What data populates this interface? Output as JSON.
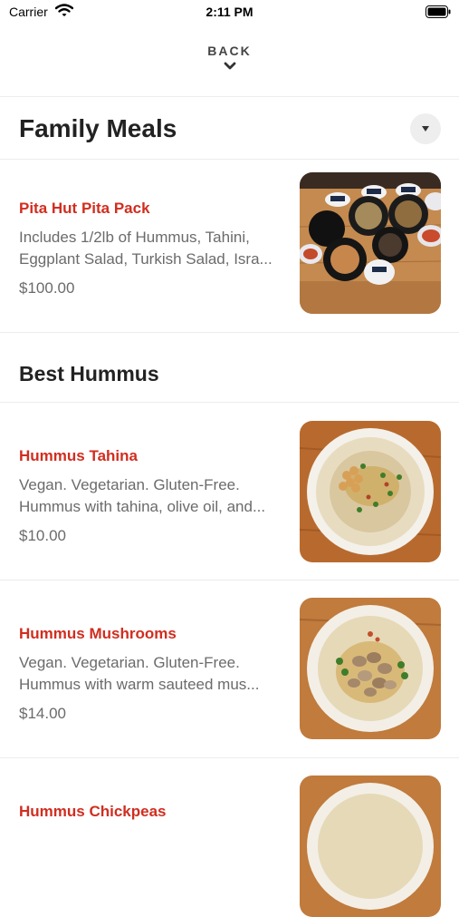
{
  "status_bar": {
    "carrier": "Carrier",
    "time": "2:11 PM"
  },
  "nav": {
    "back_label": "BACK"
  },
  "sections": [
    {
      "title": "Family Meals",
      "items": [
        {
          "name": "Pita Hut Pita Pack",
          "description_lines": [
            "Includes 1/2lb of Hummus, Tahini,",
            "Eggplant Salad, Turkish Salad, Isra..."
          ],
          "price": "$100.00"
        }
      ]
    },
    {
      "title": "Best Hummus",
      "items": [
        {
          "name": "Hummus Tahina",
          "description_lines": [
            "Vegan. Vegetarian. Gluten-Free.",
            "Hummus with tahina, olive oil, and..."
          ],
          "price": "$10.00"
        },
        {
          "name": "Hummus Mushrooms",
          "description_lines": [
            "Vegan. Vegetarian. Gluten-Free.",
            "Hummus with warm sauteed mus..."
          ],
          "price": "$14.00"
        },
        {
          "name": "Hummus Chickpeas"
        }
      ]
    }
  ]
}
